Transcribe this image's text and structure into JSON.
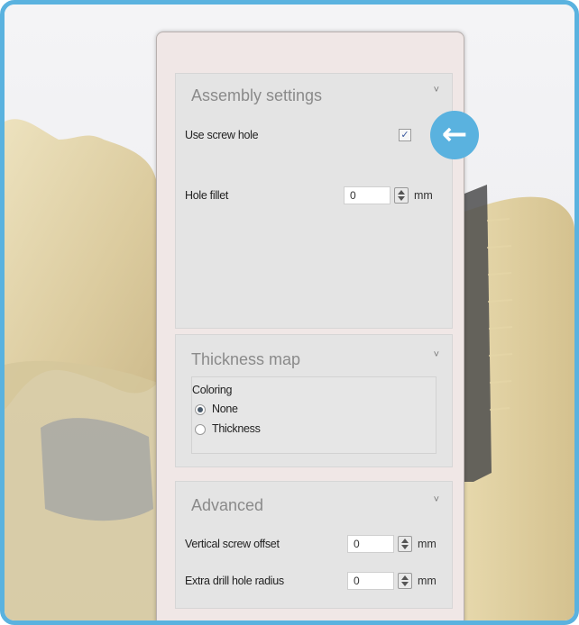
{
  "assembly": {
    "title": "Assembly settings",
    "use_screw_hole_label": "Use screw hole",
    "use_screw_hole_checked": true,
    "hole_fillet_label": "Hole fillet",
    "hole_fillet_value": "0",
    "hole_fillet_unit": "mm"
  },
  "thickness": {
    "title": "Thickness map",
    "coloring_label": "Coloring",
    "options": [
      "None",
      "Thickness"
    ],
    "selected": "None"
  },
  "advanced": {
    "title": "Advanced",
    "vertical_offset_label": "Vertical screw offset",
    "vertical_offset_value": "0",
    "vertical_offset_unit": "mm",
    "drill_radius_label": "Extra drill hole radius",
    "drill_radius_value": "0",
    "drill_radius_unit": "mm"
  },
  "icons": {
    "chevron": "chevron-down-icon",
    "check": "check-icon",
    "arrow": "arrow-left-icon"
  },
  "colors": {
    "frame_border": "#5ab2df",
    "callout": "#5ab2df",
    "model_tan": "#e2d3a6"
  }
}
